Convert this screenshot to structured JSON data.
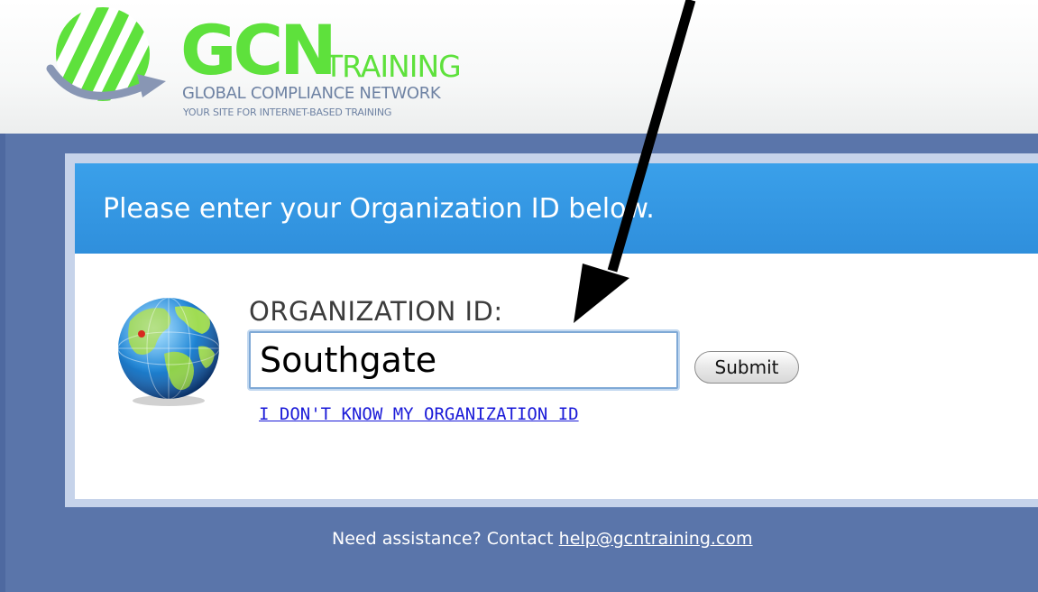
{
  "header": {
    "logo_gcn": "GCN",
    "logo_training": "TRAINING",
    "logo_network": "GLOBAL COMPLIANCE NETWORK",
    "logo_tagline": "YOUR SITE FOR INTERNET-BASED TRAINING"
  },
  "panel": {
    "title": "Please enter your Organization ID below.",
    "field_label": "ORGANIZATION ID:",
    "input_value": "Southgate",
    "submit_label": "Submit",
    "forgot_link": "I DON'T KNOW MY ORGANIZATION ID",
    "globe_icon": "globe-icon"
  },
  "footer": {
    "assist_text": "Need assistance? Contact ",
    "assist_email": "help@gcntraining.com"
  },
  "colors": {
    "brand_green": "#5ee13c",
    "brand_blue_grey": "#6e82a3",
    "band_blue": "#5a75aa",
    "panel_header_blue": "#3aa0ea",
    "link_blue": "#1a1ad8"
  },
  "annotation": {
    "icon": "arrow-icon"
  }
}
